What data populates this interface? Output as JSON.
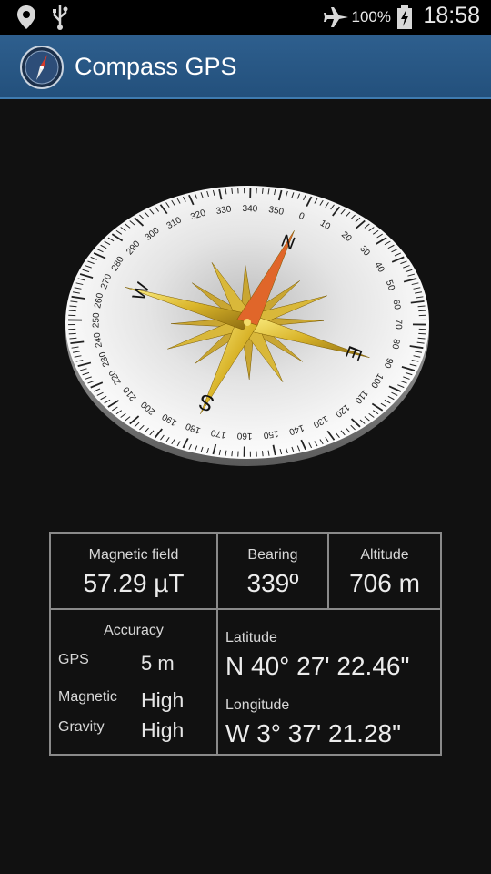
{
  "status_bar": {
    "battery_percent": "100%",
    "time": "18:58",
    "icons": [
      "location-icon",
      "usb-icon",
      "airplane-icon",
      "battery-charging-icon"
    ]
  },
  "app": {
    "title": "Compass GPS",
    "accent_color": "#2a5a88"
  },
  "compass": {
    "heading_degrees": 339,
    "cardinals": {
      "north": "N",
      "east": "E",
      "south": "S",
      "west": "W"
    },
    "degree_labels": [
      "0",
      "10",
      "20",
      "30",
      "40",
      "50",
      "60",
      "70",
      "80",
      "90",
      "100",
      "110",
      "120",
      "130",
      "140",
      "150",
      "160",
      "170",
      "180",
      "190",
      "200",
      "210",
      "220",
      "230",
      "240",
      "250",
      "260",
      "270",
      "280",
      "290",
      "300",
      "310",
      "320",
      "330",
      "340",
      "350"
    ]
  },
  "readings": {
    "magnetic_field": {
      "label": "Magnetic field",
      "value": "57.29 µT"
    },
    "bearing": {
      "label": "Bearing",
      "value": "339º"
    },
    "altitude": {
      "label": "Altitude",
      "value": "706 m"
    },
    "accuracy": {
      "label": "Accuracy",
      "gps": {
        "label": "GPS",
        "value": "5 m"
      },
      "magnetic": {
        "label": "Magnetic",
        "value": "High"
      },
      "gravity": {
        "label": "Gravity",
        "value": "High"
      }
    },
    "latitude": {
      "label": "Latitude",
      "value": "N 40° 27' 22.46\""
    },
    "longitude": {
      "label": "Longitude",
      "value": "W 3° 37' 21.28\""
    }
  }
}
